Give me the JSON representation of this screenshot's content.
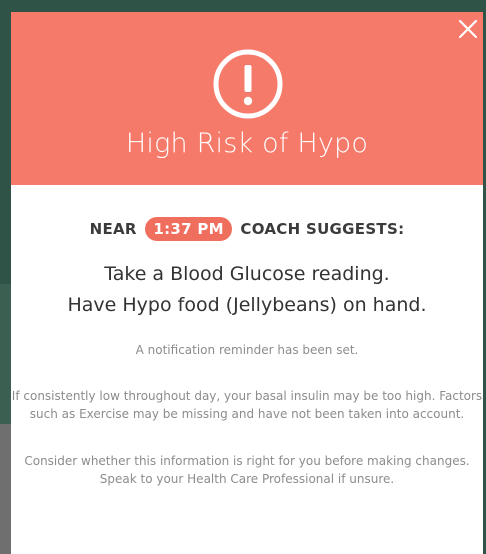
{
  "header": {
    "title": "High Risk of Hypo",
    "icon": "exclamation-circle-icon",
    "close_icon": "close-icon"
  },
  "suggestion": {
    "prefix": "NEAR",
    "time": "1:37 PM",
    "suffix": "COACH SUGGESTS:"
  },
  "actions": {
    "line1": "Take a Blood Glucose reading.",
    "line2": "Have Hypo food (Jellybeans) on hand."
  },
  "notes": {
    "reminder": "A notification reminder has been set.",
    "basal_line1": "If consistently low throughout day, your basal insulin may be too high. Factors",
    "basal_line2": "such as Exercise may be missing and have not been taken into account.",
    "disclaimer_line1": "Consider whether this information is right for you before making changes.",
    "disclaimer_line2": "Speak to your Health Care Professional if unsure."
  },
  "colors": {
    "header_bg": "#f67a6a",
    "badge_bg": "#ef6e5d",
    "backdrop": "#2f5346"
  }
}
